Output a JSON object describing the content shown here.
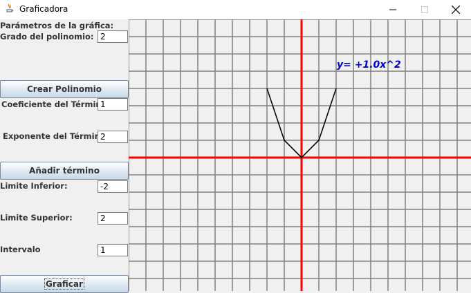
{
  "window": {
    "title": "Graficadora",
    "icon": "java-app-icon"
  },
  "panel": {
    "params_label": "Parámetros de la gráfica:",
    "grado_label": "Grado del polinomio:",
    "grado_value": "2",
    "crear_button": "Crear Polinomio",
    "coef_label": "Coeficiente del Término:",
    "coef_value": "1",
    "exp_label": "Exponente del Término:",
    "exp_value": "2",
    "anadir_button": "Añadir término",
    "lim_inf_label": "Limite Inferior:",
    "lim_inf_value": "-2",
    "lim_sup_label": "Limite Superior:",
    "lim_sup_value": "2",
    "intervalo_label": "Intervalo",
    "intervalo_value": "1",
    "graficar_button": "Graficar"
  },
  "graph": {
    "equation": "y= +1.0x^2",
    "axis_color": "#ff0000",
    "grid_color": "#808080",
    "curve_color": "#000000",
    "equation_color": "#0000cc",
    "points": [
      [
        -2,
        4
      ],
      [
        -1,
        1
      ],
      [
        0,
        0
      ],
      [
        1,
        1
      ],
      [
        2,
        4
      ]
    ]
  }
}
